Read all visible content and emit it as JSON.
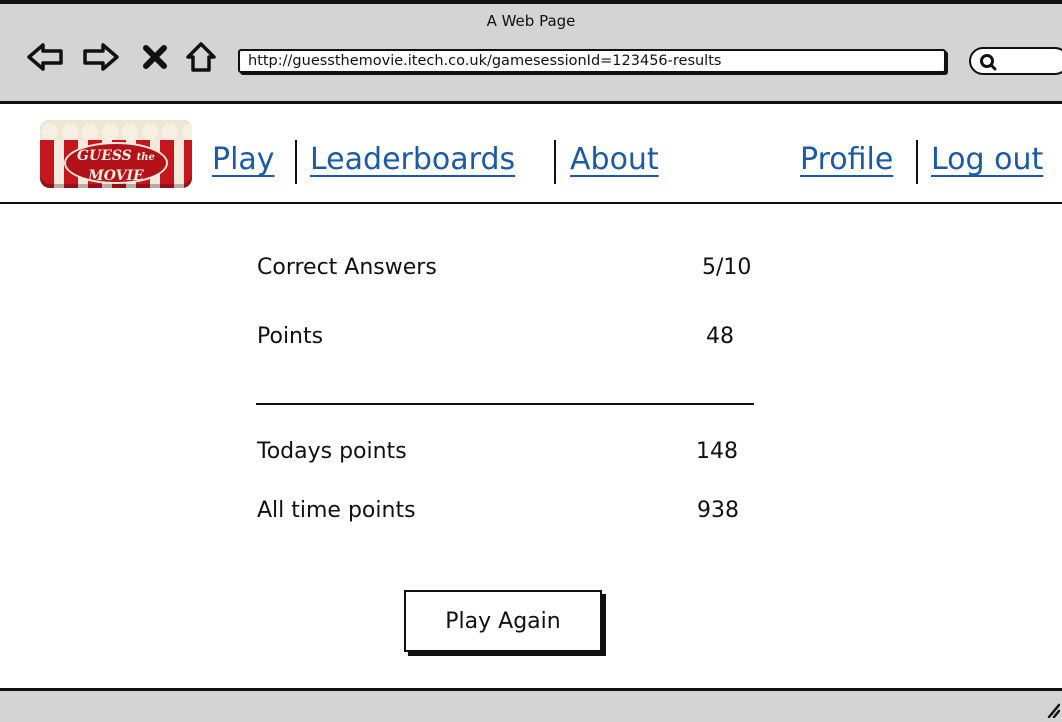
{
  "window": {
    "title": "A Web Page"
  },
  "browser": {
    "address": "http://guessthemovie.itech.co.uk/gamesessionId=123456-results"
  },
  "logo": {
    "line1": "GUESS",
    "line2": "the",
    "line3": "MOVIE"
  },
  "nav": {
    "play": "Play",
    "leaderboards": "Leaderboards",
    "about": "About",
    "profile": "Profile",
    "logout": "Log out"
  },
  "results": {
    "correct_label": "Correct Answers",
    "correct_value": "5/10",
    "points_label": "Points",
    "points_value": "48",
    "todays_label": "Todays points",
    "todays_value": "148",
    "alltime_label": "All time points",
    "alltime_value": "938"
  },
  "actions": {
    "play_again": "Play Again"
  },
  "colors": {
    "link": "#1a5aa8",
    "chrome": "#d4d4d4",
    "logo_red": "#c4161c"
  }
}
